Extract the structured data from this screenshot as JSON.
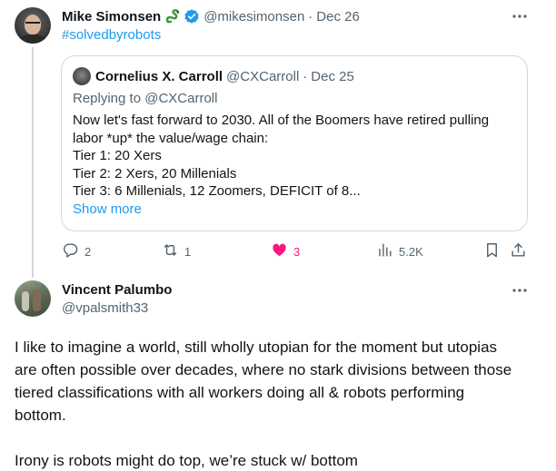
{
  "tweet": {
    "author_name": "Mike Simonsen",
    "author_emoji_icon": "snake-emoji",
    "verified_icon": "verified-badge-icon",
    "handle": "@mikesimonsen",
    "separator": "·",
    "date": "Dec 26",
    "hashtag": "#solvedbyrobots",
    "more_icon": "more-icon",
    "quote": {
      "author_name": "Cornelius X. Carroll",
      "handle": "@CXCarroll",
      "separator": "·",
      "date": "Dec 25",
      "replying_to": "Replying to @CXCarroll",
      "body_lines": [
        "Now let's fast forward to 2030. All of the Boomers have retired pulling",
        "labor *up* the value/wage chain:",
        "Tier 1: 20 Xers",
        "Tier 2: 2 Xers, 20 Millenials",
        "Tier 3: 6 Millenials, 12 Zoomers, DEFICIT of 8..."
      ],
      "show_more": "Show more"
    },
    "actions": {
      "reply_count": "2",
      "retweet_count": "1",
      "like_count": "3",
      "view_count": "5.2K",
      "like_color": "#f91880",
      "icons": [
        "reply-icon",
        "retweet-icon",
        "like-icon",
        "views-icon",
        "bookmark-icon",
        "share-icon"
      ]
    }
  },
  "reply": {
    "author_name": "Vincent Palumbo",
    "handle": "@vpalsmith33",
    "more_icon": "more-icon",
    "body_paragraph_1": [
      "I like to imagine a world, still wholly utopian for the moment but utopias",
      "are often possible over decades, where no stark divisions between those",
      "tiered classifications with all workers doing all & robots performing",
      "bottom."
    ],
    "body_paragraph_2": "Irony is robots might do top, we’re stuck w/ bottom"
  },
  "colors": {
    "link": "#1d9bf0",
    "text": "#0f1419",
    "muted": "#536471",
    "border": "#cfd9de",
    "verified": "#1d9bf0"
  }
}
